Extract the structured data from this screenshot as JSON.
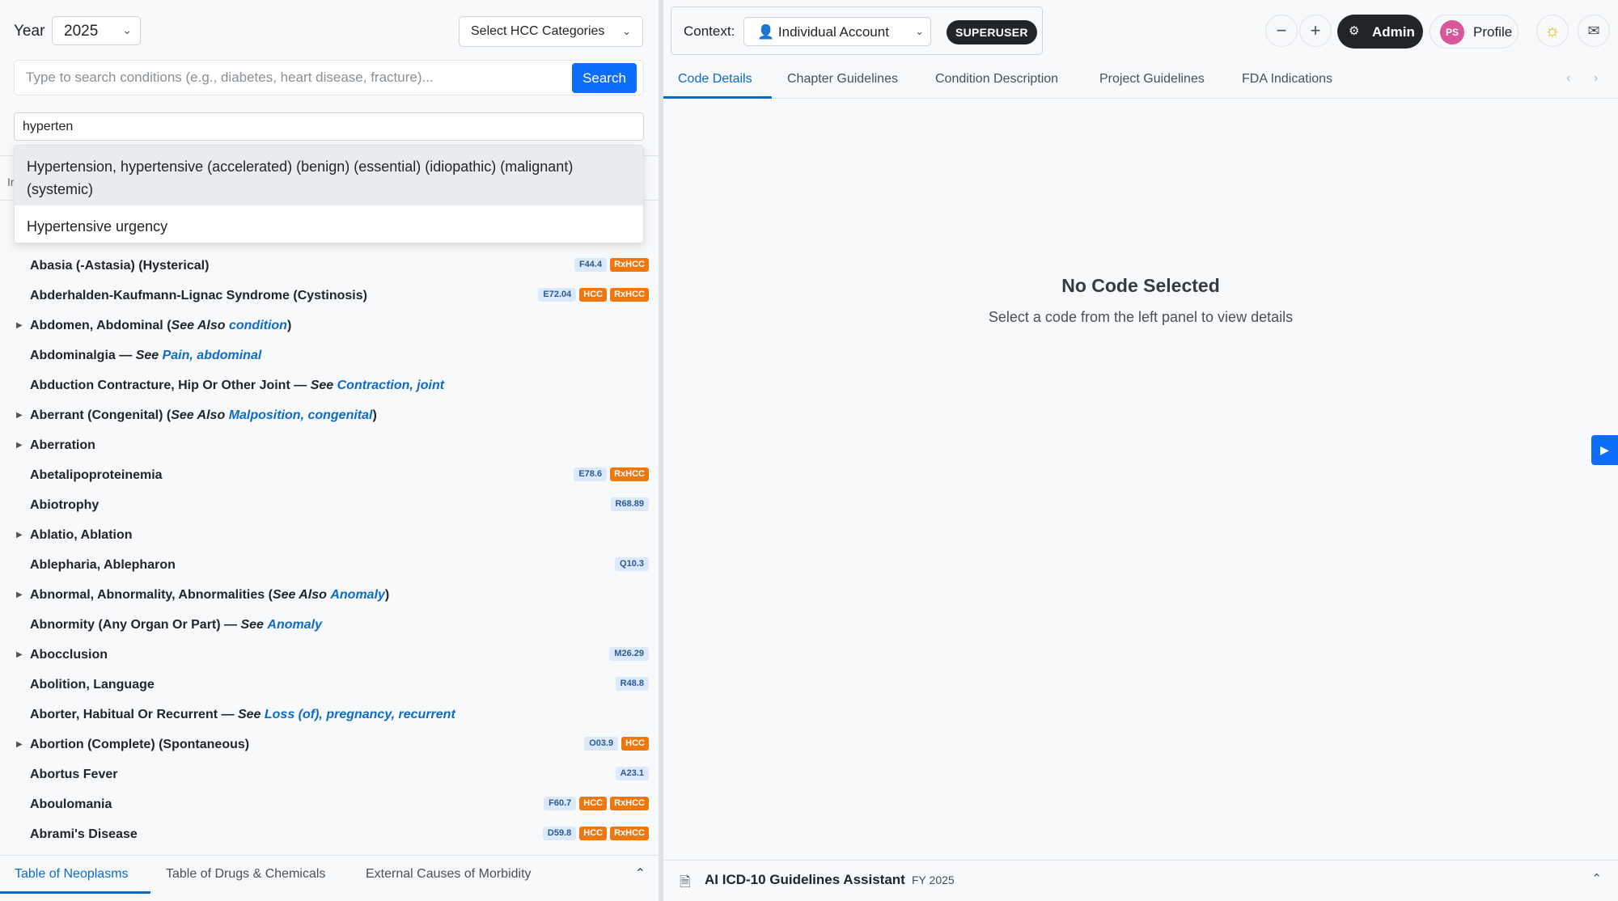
{
  "filters": {
    "year_label": "Year",
    "year_value": "2025",
    "hcc_label": "Select HCC Categories",
    "search_placeholder": "Type to search conditions (e.g., diabetes, heart disease, fracture)...",
    "search_button": "Search",
    "filter_value": "hyperten"
  },
  "suggestions": [
    "Hypertension, hypertensive (accelerated) (benign) (essential) (idiopathic) (malignant) (systemic)",
    "Hypertensive urgency"
  ],
  "behind_text": "Ir",
  "index": [
    {
      "term": "Abasia (-Astasia) (Hysterical)",
      "expand": false,
      "code": "F44.4",
      "hcc": false,
      "rxhcc": true
    },
    {
      "term": "Abderhalden-Kaufmann-Lignac Syndrome (Cystinosis)",
      "expand": false,
      "code": "E72.04",
      "hcc": true,
      "rxhcc": true
    },
    {
      "term": "Abdomen, Abdominal",
      "expand": true,
      "see_prefix": "(",
      "see": "See Also",
      "link": "condition",
      "see_suffix": ")"
    },
    {
      "term": "Abdominalgia",
      "expand": false,
      "see_prefix": "— ",
      "see": "See",
      "link": "Pain, abdominal"
    },
    {
      "term": "Abduction Contracture, Hip Or Other Joint",
      "expand": false,
      "see_prefix": "— ",
      "see": "See",
      "link": "Contraction, joint"
    },
    {
      "term": "Aberrant (Congenital)",
      "expand": true,
      "see_prefix": "(",
      "see": "See Also",
      "link": "Malposition, congenital",
      "see_suffix": ")"
    },
    {
      "term": "Aberration",
      "expand": true
    },
    {
      "term": "Abetalipoproteinemia",
      "expand": false,
      "code": "E78.6",
      "hcc": false,
      "rxhcc": true
    },
    {
      "term": "Abiotrophy",
      "expand": false,
      "code": "R68.89"
    },
    {
      "term": "Ablatio, Ablation",
      "expand": true
    },
    {
      "term": "Ablepharia, Ablepharon",
      "expand": false,
      "code": "Q10.3"
    },
    {
      "term": "Abnormal, Abnormality, Abnormalities",
      "expand": true,
      "see_prefix": "(",
      "see": "See Also",
      "link": "Anomaly",
      "see_suffix": ")"
    },
    {
      "term": "Abnormity (Any Organ Or Part)",
      "expand": false,
      "see_prefix": "— ",
      "see": "See",
      "link": "Anomaly"
    },
    {
      "term": "Abocclusion",
      "expand": true,
      "code": "M26.29"
    },
    {
      "term": "Abolition, Language",
      "expand": false,
      "code": "R48.8"
    },
    {
      "term": "Aborter, Habitual Or Recurrent",
      "expand": false,
      "see_prefix": "— ",
      "see": "See",
      "link": "Loss (of), pregnancy, recurrent"
    },
    {
      "term": "Abortion (Complete) (Spontaneous)",
      "expand": true,
      "code": "O03.9",
      "hcc": true
    },
    {
      "term": "Abortus Fever",
      "expand": false,
      "code": "A23.1"
    },
    {
      "term": "Aboulomania",
      "expand": false,
      "code": "F60.7",
      "hcc": true,
      "rxhcc": true
    },
    {
      "term": "Abrami's Disease",
      "expand": false,
      "code": "D59.8",
      "hcc": true,
      "rxhcc": true
    }
  ],
  "badge_labels": {
    "hcc": "HCC",
    "rxhcc": "RxHCC"
  },
  "bottom_tabs": [
    "Table of Neoplasms",
    "Table of Drugs & Chemicals",
    "External Causes of Morbidity"
  ],
  "context": {
    "label": "Context:",
    "account_icon": "👤",
    "account": "Individual Account",
    "badge": "SUPERUSER"
  },
  "toolbar": {
    "zoom_out": "−",
    "zoom_in": "+",
    "admin_icon": "gear-icon",
    "admin": "Admin",
    "avatar_initials": "PS",
    "profile": "Profile"
  },
  "detail_tabs": [
    "Code Details",
    "Chapter Guidelines",
    "Condition Description",
    "Project Guidelines",
    "FDA Indications"
  ],
  "empty_state": {
    "title": "No Code Selected",
    "subtitle": "Select a code from the left panel to view details"
  },
  "assistant": {
    "title": "AI ICD-10 Guidelines Assistant",
    "fy": "FY 2025"
  },
  "colors": {
    "accent": "#0d6efd",
    "link": "#0b6bcb",
    "hcc_badge": "#f0760e",
    "code_badge": "#dce9fb"
  }
}
